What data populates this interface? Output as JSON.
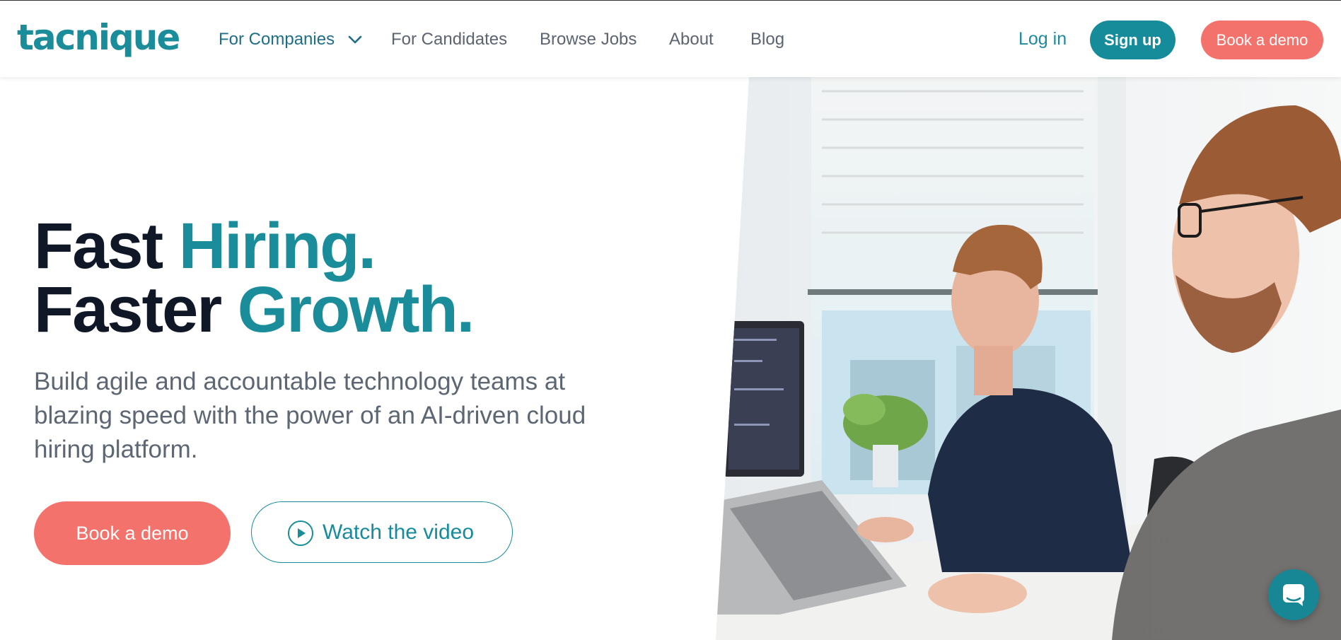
{
  "brand": {
    "logo_text": "tacnique",
    "accent": "#1a8c9a",
    "coral": "#f4726c"
  },
  "nav": {
    "items": [
      {
        "label": "For Companies",
        "has_dropdown": true
      },
      {
        "label": "For Candidates"
      },
      {
        "label": "Browse Jobs"
      },
      {
        "label": "About"
      },
      {
        "label": "Blog"
      }
    ],
    "login": "Log in",
    "signup": "Sign up",
    "book_demo": "Book a demo"
  },
  "hero": {
    "line1_dark": "Fast ",
    "line1_accent": "Hiring.",
    "line2_dark": "Faster ",
    "line2_accent": "Growth.",
    "subtitle": "Build agile and accountable technology teams at blazing speed with the power of an AI-driven cloud hiring platform.",
    "cta_primary": "Book a demo",
    "cta_video": "Watch the video"
  },
  "icons": {
    "dropdown": "chevron-down-icon",
    "play": "play-circle-icon",
    "chat": "chat-icon"
  }
}
